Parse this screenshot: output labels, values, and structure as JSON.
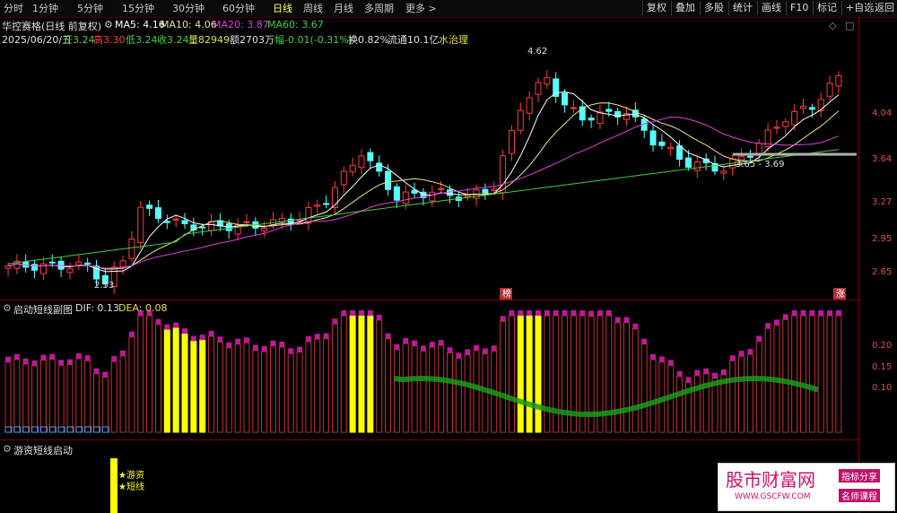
{
  "toolbar": {
    "periods": [
      "分时",
      "1分钟",
      "5分钟",
      "15分钟",
      "30分钟",
      "60分钟",
      "日线",
      "周线",
      "月线",
      "多周期",
      "更多 >"
    ],
    "active_period": "日线",
    "right_buttons": [
      "复权",
      "叠加",
      "多股",
      "统计",
      "画线",
      "F10",
      "标记",
      "+自选",
      "返回"
    ]
  },
  "main_chart": {
    "stock_name": "华控赛格(日线 前复权)",
    "ma5": "MA5: 4.16",
    "ma10": "MA10: 4.06",
    "ma20": "MA20: 3.87",
    "ma60": "MA60: 3.67",
    "date": "2025/06/20/五",
    "open": "开3.24",
    "high": "高3.30",
    "low": "低3.24",
    "close": "收3.24",
    "volume": "量82949",
    "amount": "额2703万",
    "change": "幅-0.01(-0.31%)",
    "turnover": "换0.82%",
    "float_cap": "流通10.1亿",
    "concept": "水治理",
    "high_marker": "4.62",
    "low_marker": "2.53",
    "range_label": "3.65 - 3.69",
    "tag_bang": "榜",
    "tag_zhang": "涨",
    "y_labels": [
      "4.04",
      "3.64",
      "3.27",
      "2.95",
      "2.65"
    ]
  },
  "indicator1": {
    "title": "启动短线副图",
    "dif": "DIF: 0.13",
    "dea": "DEA: 0.08",
    "y_labels": [
      "0.20",
      "0.15",
      "0.10"
    ]
  },
  "indicator2": {
    "title": "游资短线启动",
    "signal_line1": "★游资",
    "signal_line2": "★短线"
  },
  "watermark": {
    "name": "股市财富网",
    "url": "WWW.GSCFW.COM",
    "tag1": "指标分享",
    "tag2": "名师课程"
  },
  "colors": {
    "up": "#ff3c3c",
    "down": "#54ffff",
    "ma5": "#ffffff",
    "ma10": "#e6e68c",
    "ma20": "#e040e0",
    "ma60": "#40d040",
    "yellow": "#ffff00",
    "magenta": "#c0189a",
    "green": "#1a9a1a"
  }
}
